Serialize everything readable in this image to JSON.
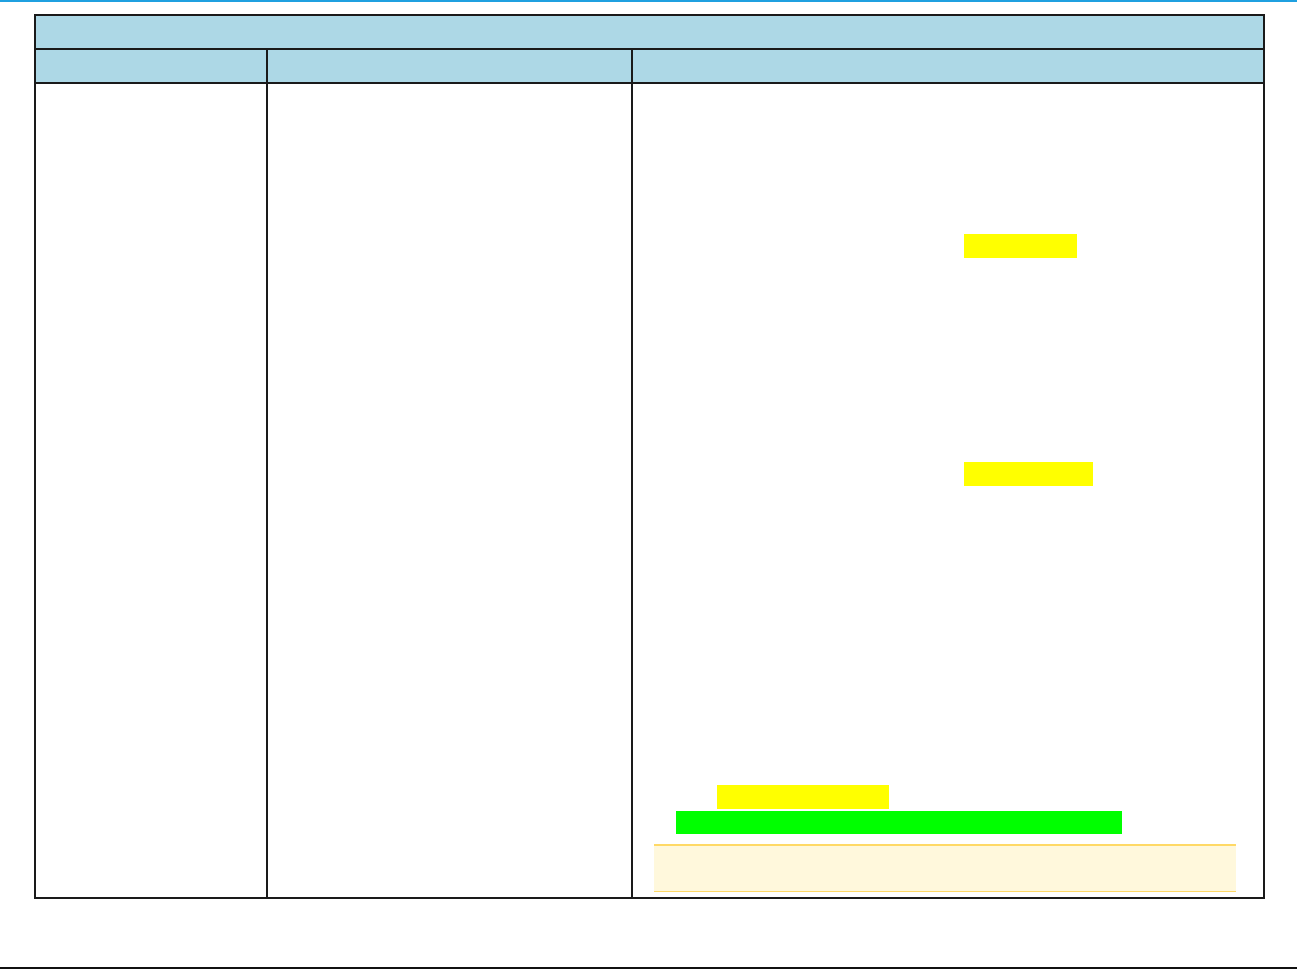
{
  "table": {
    "title": "",
    "headers": [
      "",
      "",
      ""
    ],
    "cells": [
      "",
      "",
      ""
    ]
  },
  "highlights": [
    "",
    "",
    "",
    "",
    ""
  ],
  "note": "",
  "colors": {
    "header_bg": "#add8e6",
    "top_rule": "#1fa0e0",
    "highlight_yellow": "#ffff00",
    "highlight_green": "#00ff00",
    "note_bg": "#fff8dc",
    "note_border": "#ffd966"
  }
}
